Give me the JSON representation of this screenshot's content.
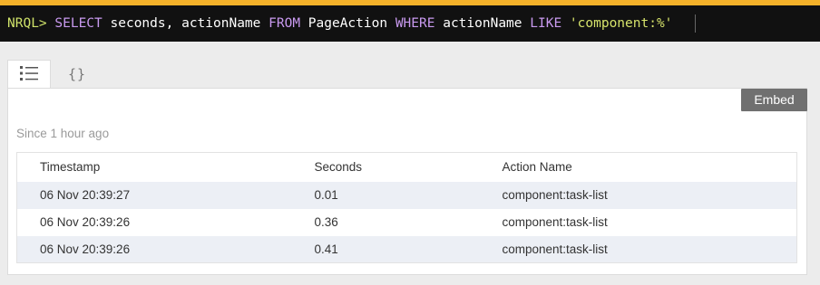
{
  "query": {
    "prompt": "NRQL>",
    "kw_select": "SELECT",
    "fields": "seconds, actionName",
    "kw_from": "FROM",
    "table": "PageAction",
    "kw_where": "WHERE",
    "where_field": "actionName",
    "kw_like": "LIKE",
    "pattern": "'component:%'"
  },
  "tabs": [
    {
      "name": "table",
      "icon": "list-icon",
      "active": true
    },
    {
      "name": "json",
      "label": "{}",
      "icon": "braces-icon",
      "active": false
    }
  ],
  "embed_label": "Embed",
  "since_label": "Since 1 hour ago",
  "table": {
    "columns": [
      "Timestamp",
      "Seconds",
      "Action Name"
    ],
    "rows": [
      [
        "06 Nov 20:39:27",
        "0.01",
        "component:task-list"
      ],
      [
        "06 Nov 20:39:26",
        "0.36",
        "component:task-list"
      ],
      [
        "06 Nov 20:39:26",
        "0.41",
        "component:task-list"
      ]
    ]
  },
  "colors": {
    "accent": "#f5b22a",
    "query_bg": "#111111",
    "keyword": "#c99af0",
    "string": "#d6e36b",
    "embed_bg": "#707070",
    "row_alt": "#eceff5"
  }
}
